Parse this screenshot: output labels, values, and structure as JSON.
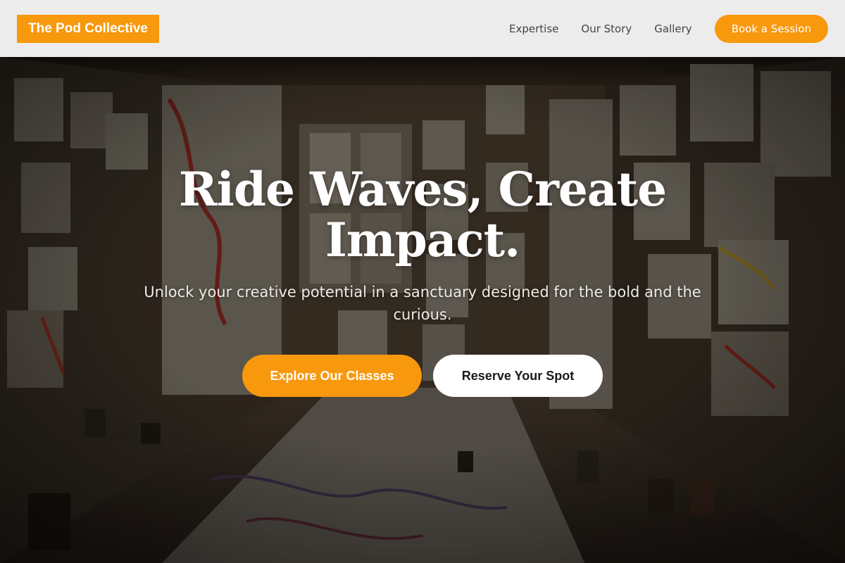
{
  "brand": {
    "name": "The Pod Collective",
    "accent_color": "#f8980c"
  },
  "nav": {
    "links": [
      "Expertise",
      "Our Story",
      "Gallery"
    ],
    "cta_label": "Book a Session"
  },
  "hero": {
    "headline": "Ride Waves, Create Impact.",
    "subheadline": "Unlock your creative potential in a sanctuary designed for the bold and the curious.",
    "primary_cta": "Explore Our Classes",
    "secondary_cta": "Reserve Your Spot",
    "background": "art-studio-photo"
  }
}
